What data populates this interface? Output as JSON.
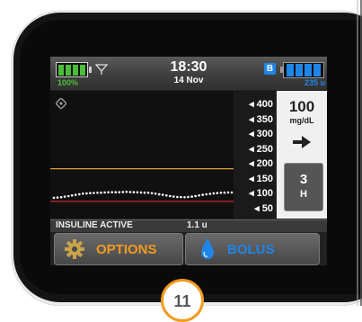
{
  "status": {
    "battery_percent": "100%",
    "battery_level": 1.0,
    "time": "18:30",
    "date": "14 Nov",
    "bluetooth_badge": "B",
    "insulin_units": "235 u",
    "reservoir_level": 1.0
  },
  "graph": {
    "axis_ticks": [
      "400",
      "350",
      "300",
      "250",
      "200",
      "150",
      "100",
      "50"
    ],
    "target_high": 180,
    "target_low": 70,
    "trace": [
      82,
      84,
      88,
      92,
      96,
      98,
      99,
      100,
      101,
      101,
      102,
      101,
      100,
      99,
      96,
      92,
      88,
      85,
      84,
      86,
      90,
      94,
      97,
      99,
      100
    ]
  },
  "glucose": {
    "value": "100",
    "unit": "mg/dL",
    "trend_icon": "arrow-right-icon",
    "hours_value": "3",
    "hours_unit": "H"
  },
  "insulin_active": {
    "label": "INSULINE ACTIVE",
    "value": "1.1 u"
  },
  "buttons": {
    "options_label": "OPTIONS",
    "bolus_label": "BOLUS",
    "options_icon": "gear-icon",
    "bolus_icon": "drop-icon"
  },
  "callout": {
    "number": "11"
  },
  "colors": {
    "green": "#4cbc3a",
    "blue": "#1f86e8",
    "orange": "#f39a1e",
    "target_high_line": "#d9a23a",
    "target_low_line": "#cc2b2b"
  }
}
